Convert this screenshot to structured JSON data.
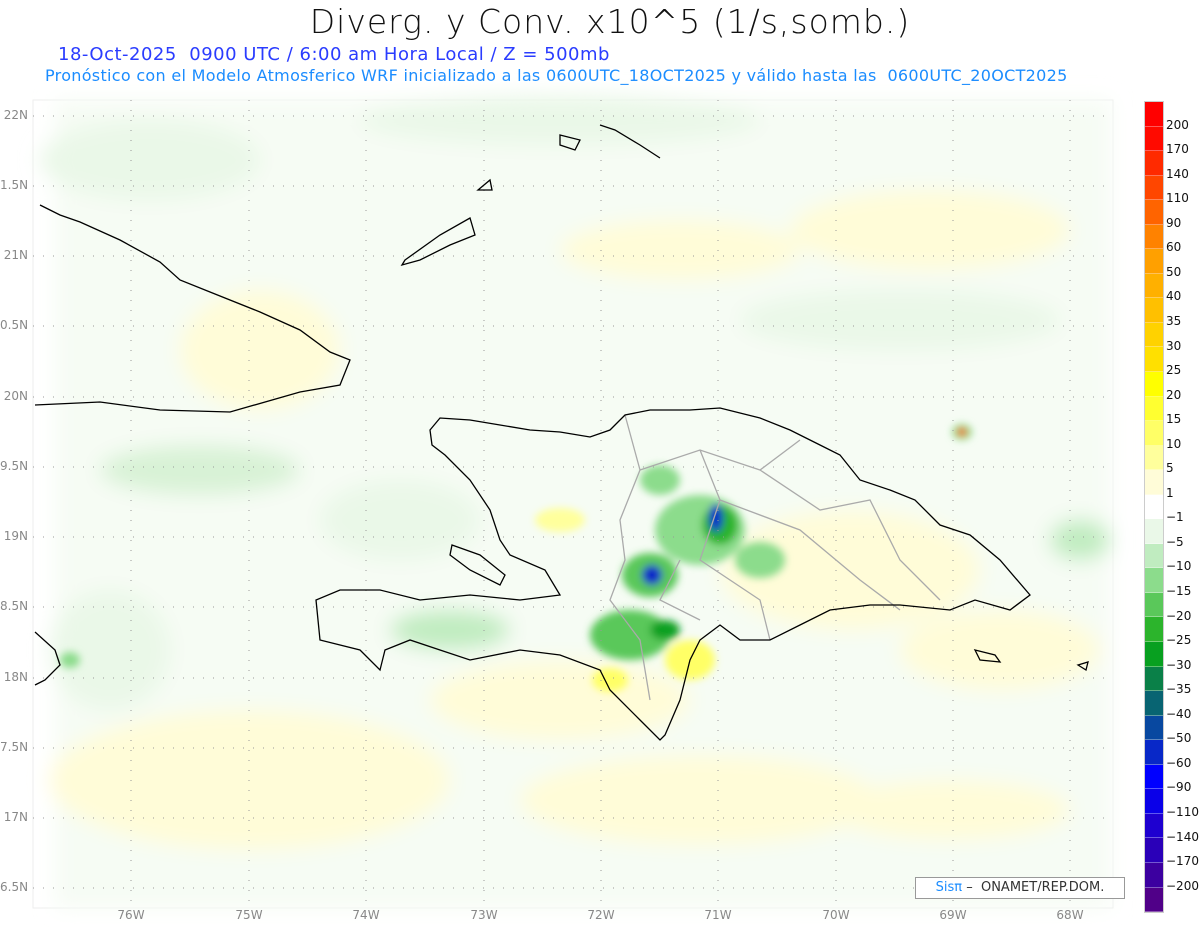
{
  "title": "Diverg. y Conv. x10^5 (1/s,somb.)",
  "subtitle_date": "18-Oct-2025  0900 UTC / 6:00 am Hora Local / Z = 500mb",
  "subtitle_model": "Pronóstico con el Modelo Atmosferico WRF inicializado a las 0600UTC_18OCT2025 y válido hasta las  0600UTC_20OCT2025",
  "lat_labels": [
    "22N",
    "1.5N",
    "21N",
    "0.5N",
    "20N",
    "9.5N",
    "19N",
    "8.5N",
    "18N",
    "7.5N",
    "17N",
    "6.5N"
  ],
  "lon_labels": [
    "76W",
    "75W",
    "74W",
    "73W",
    "72W",
    "71W",
    "70W",
    "69W",
    "68W"
  ],
  "colorbar": {
    "labels": [
      "200",
      "170",
      "140",
      "110",
      "90",
      "60",
      "50",
      "40",
      "35",
      "30",
      "25",
      "20",
      "15",
      "10",
      "5",
      "1",
      "−1",
      "−5",
      "−10",
      "−15",
      "−20",
      "−25",
      "−30",
      "−35",
      "−40",
      "−50",
      "−60",
      "−90",
      "−110",
      "−140",
      "−170",
      "−200"
    ],
    "colors": [
      "#ff0000",
      "#ff0a00",
      "#ff2a00",
      "#ff4600",
      "#ff6400",
      "#ff8200",
      "#ffa000",
      "#ffb000",
      "#ffc000",
      "#ffd200",
      "#ffe000",
      "#ffff00",
      "#ffff30",
      "#ffff66",
      "#ffff9c",
      "#fffcd8",
      "#ffffff",
      "#eaf8e8",
      "#c0ecc0",
      "#8cdc8c",
      "#5ac85a",
      "#2cb42c",
      "#08a020",
      "#0a8048",
      "#086472",
      "#0848a0",
      "#0828c8",
      "#0000ff",
      "#0a00e8",
      "#1e00d0",
      "#2a00b8",
      "#3c00a0",
      "#500088"
    ]
  },
  "credit": {
    "brand": "Sisπ",
    "text": " –  ONAMET/REP.DOM."
  }
}
